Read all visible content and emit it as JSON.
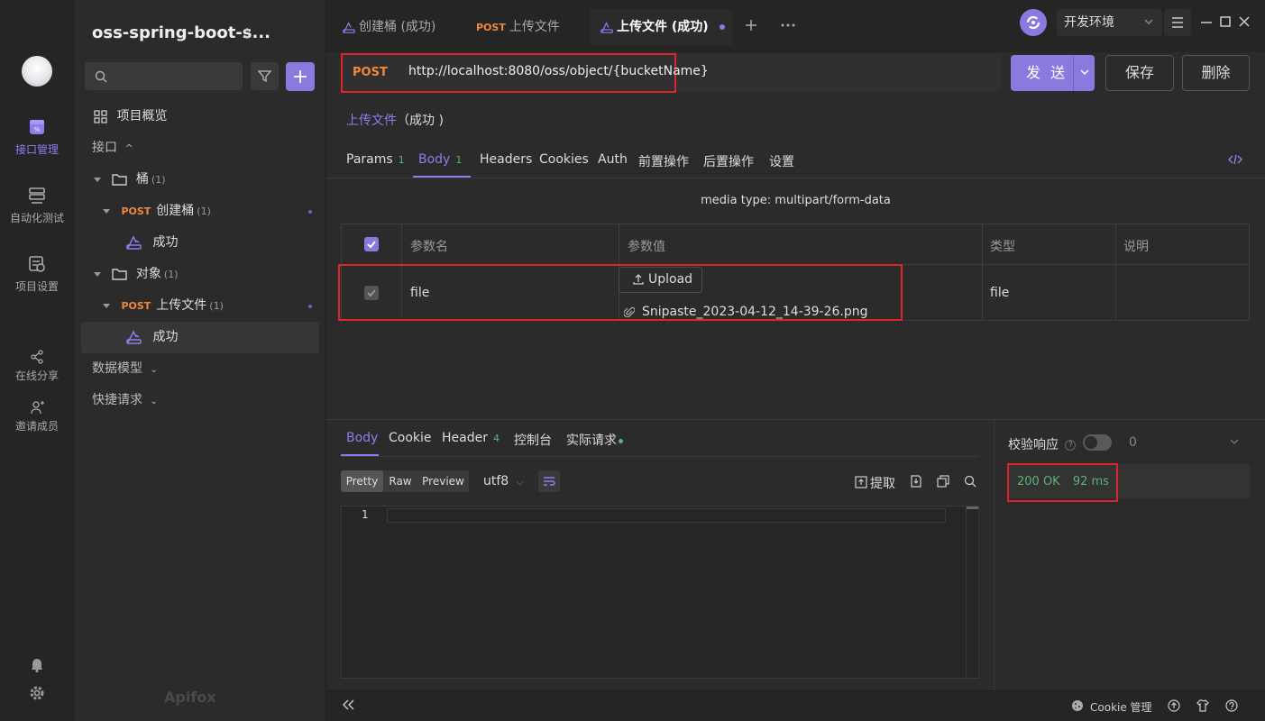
{
  "project": {
    "name": "oss-spring-boot-s..."
  },
  "rail": {
    "items": [
      {
        "label": "接口管理",
        "icon": "api-icon",
        "active": true
      },
      {
        "label": "自动化测试",
        "icon": "automation-icon"
      },
      {
        "label": "项目设置",
        "icon": "settings-icon"
      },
      {
        "label": "在线分享",
        "icon": "share-icon"
      },
      {
        "label": "邀请成员",
        "icon": "invite-icon"
      }
    ]
  },
  "sidebar": {
    "overview": "项目概览",
    "interfaces": "接口",
    "folder_bucket": {
      "label": "桶",
      "count": "(1)"
    },
    "create_bucket": {
      "method": "POST",
      "label": "创建桶",
      "count": "(1)"
    },
    "case1": "成功",
    "folder_object": {
      "label": "对象",
      "count": "(1)"
    },
    "upload_file": {
      "method": "POST",
      "label": "上传文件",
      "count": "(1)"
    },
    "case2": "成功",
    "data_model": "数据模型",
    "quick_request": "快捷请求",
    "brand": "Apifox"
  },
  "tabs": [
    {
      "label": "创建桶 (成功)"
    },
    {
      "method": "POST",
      "label": "上传文件"
    },
    {
      "label": "上传文件 (成功)",
      "active": true
    }
  ],
  "env": {
    "label": "开发环境"
  },
  "request": {
    "method": "POST",
    "url": "http://localhost:8080/oss/object/{bucketName}",
    "send": "发 送",
    "save": "保存",
    "delete": "删除",
    "name": "上传文件",
    "name_suffix": "（成功 )"
  },
  "req_tabs": [
    {
      "label": "Params",
      "badge": "1"
    },
    {
      "label": "Body",
      "badge": "1",
      "active": true
    },
    {
      "label": "Headers"
    },
    {
      "label": "Cookies"
    },
    {
      "label": "Auth"
    },
    {
      "label": "前置操作"
    },
    {
      "label": "后置操作"
    },
    {
      "label": "设置"
    }
  ],
  "body": {
    "media_type": "media type: multipart/form-data",
    "headers": [
      "参数名",
      "参数值",
      "类型",
      "说明"
    ],
    "row": {
      "name": "file",
      "upload": "Upload",
      "filename": "Snipaste_2023-04-12_14-39-26.png",
      "type": "file"
    }
  },
  "response": {
    "tabs": [
      {
        "label": "Body",
        "active": true
      },
      {
        "label": "Cookie"
      },
      {
        "label": "Header",
        "badge": "4"
      },
      {
        "label": "控制台"
      },
      {
        "label": "实际请求"
      }
    ],
    "modes": [
      "Pretty",
      "Raw",
      "Preview"
    ],
    "encoding": "utf8",
    "extract": "提取",
    "line_number": "1",
    "validate": "校验响应",
    "validate_count": "0",
    "status": "200 OK",
    "time": "92 ms"
  },
  "statusbar": {
    "cookie": "Cookie 管理"
  },
  "colors": {
    "accent": "#8a7ae0",
    "post": "#f0883e",
    "ok": "#5cb37a",
    "highlight": "#e0222b"
  }
}
